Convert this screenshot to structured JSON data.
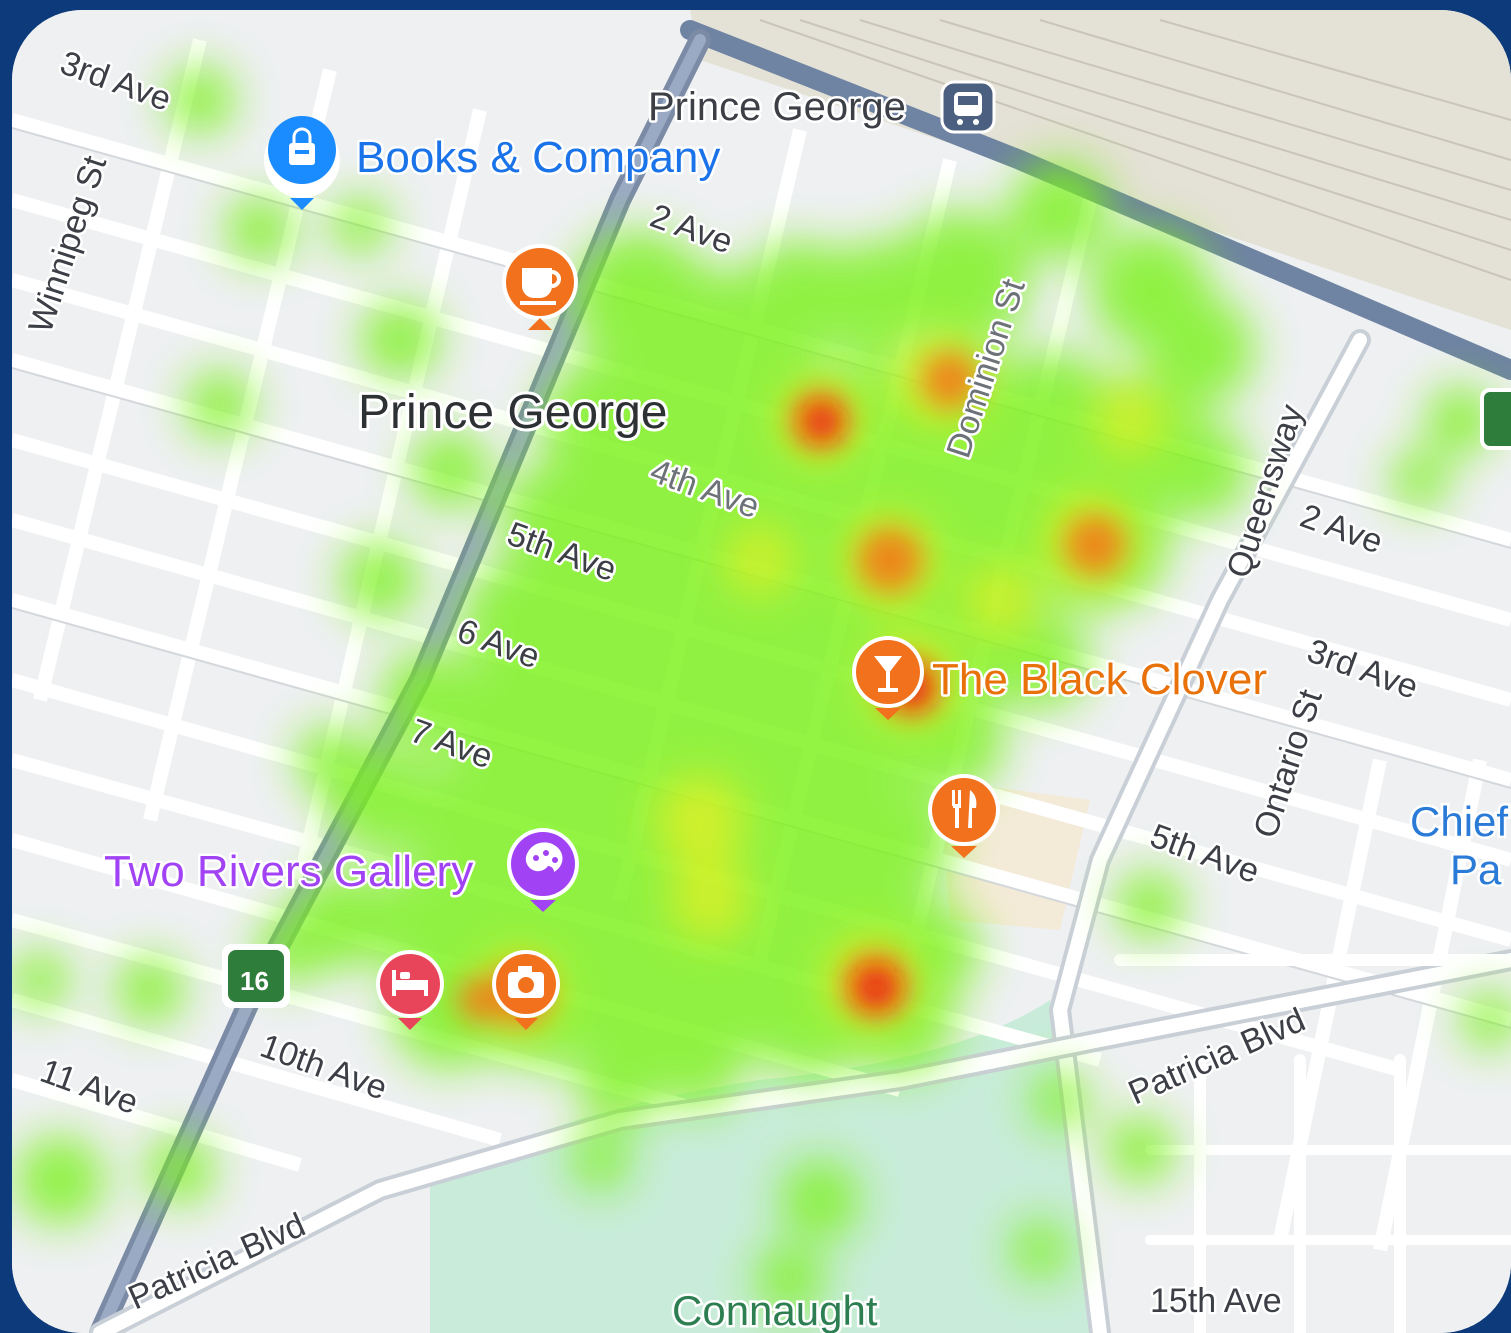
{
  "map": {
    "city_label": "Prince George",
    "park_label": "Connaught",
    "edge_label_line1": "Chief",
    "edge_label_line2": "Pa",
    "highway_shield": "16",
    "heatmap_colors": {
      "low": "#7cf21a",
      "mid": "#e8f020",
      "high": "#f07a14",
      "peak": "#e81c10"
    }
  },
  "stations": {
    "prince_george": {
      "label": "Prince George",
      "icon": "train-station-icon"
    }
  },
  "streets": {
    "third_ave_nw": "3rd Ave",
    "winnipeg_st": "Winnipeg St",
    "second_ave": "2 Ave",
    "fourth_ave": "4th Ave",
    "fifth_ave": "5th Ave",
    "sixth_ave": "6 Ave",
    "seventh_ave": "7 Ave",
    "tenth_ave": "10th Ave",
    "eleventh_ave": "11 Ave",
    "patricia_blvd_sw": "Patricia Blvd",
    "dominion_st": "Dominion St",
    "queensway": "Queensway",
    "second_ave_east": "2 Ave",
    "third_ave_east": "3rd Ave",
    "ontario_st": "Ontario St",
    "fifth_ave_east": "5th Ave",
    "patricia_blvd_east": "Patricia Blvd",
    "fifteenth_ave": "15th Ave"
  },
  "pois": {
    "books_company": {
      "label": "Books & Company",
      "icon": "shopping-bag-icon",
      "color": "#1a8cff"
    },
    "cafe": {
      "icon": "coffee-cup-icon",
      "color": "#f2711c"
    },
    "black_clover": {
      "label": "The Black Clover",
      "icon": "cocktail-icon",
      "color": "#e8710a"
    },
    "restaurant": {
      "icon": "fork-knife-icon",
      "color": "#f2711c"
    },
    "two_rivers_gallery": {
      "label": "Two Rivers Gallery",
      "icon": "palette-icon",
      "color": "#a142f4"
    },
    "hotel": {
      "icon": "bed-icon",
      "color": "#e8455b"
    },
    "camera_shop": {
      "icon": "camera-icon",
      "color": "#f2711c"
    }
  }
}
